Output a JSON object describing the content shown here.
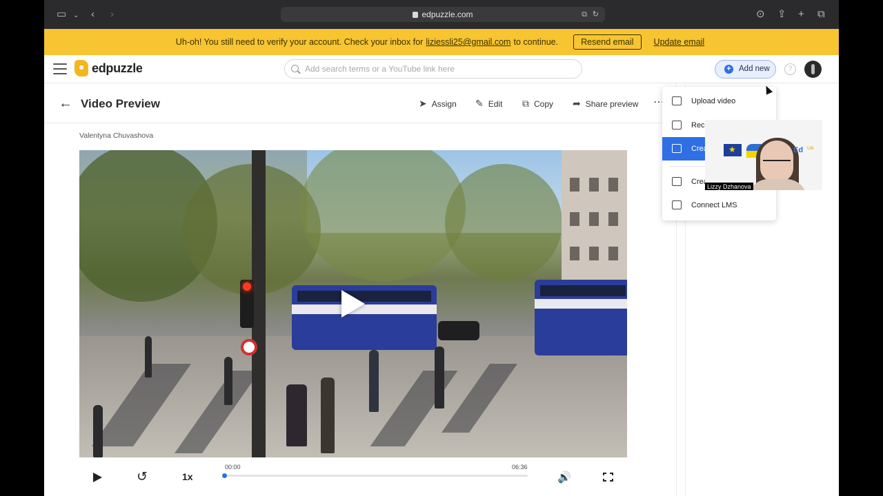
{
  "browser": {
    "url": "edpuzzle.com",
    "icons": [
      "sidebar-icon",
      "chevron-down-icon",
      "back-icon",
      "forward-icon",
      "translate-icon",
      "reload-icon",
      "download-icon",
      "share-icon",
      "plus-icon",
      "tabs-icon"
    ]
  },
  "banner": {
    "message_prefix": "Uh-oh! You still need to verify your account. Check your inbox for",
    "email": "liziessli25@gmail.com",
    "message_suffix": "to continue.",
    "resend_label": "Resend email",
    "update_label": "Update email",
    "color": "#f6c531"
  },
  "header": {
    "brand": "edpuzzle",
    "search_placeholder": "Add search terms or a YouTube link here",
    "add_new_label": "Add new",
    "help_glyph": "?",
    "accent": "#2f6fe5"
  },
  "toolbar": {
    "back_glyph": "←",
    "title": "Video Preview",
    "actions": [
      {
        "label": "Assign",
        "icon": "send-icon",
        "glyph": "➤"
      },
      {
        "label": "Edit",
        "icon": "pencil-icon",
        "glyph": "✎"
      },
      {
        "label": "Copy",
        "icon": "copy-icon",
        "glyph": "⧉"
      },
      {
        "label": "Share preview",
        "icon": "share-arrow-icon",
        "glyph": "➦"
      }
    ],
    "more_glyph": "⋯"
  },
  "video": {
    "author": "Valentyna Chuvashova",
    "speed": "1x",
    "current_time": "00:00",
    "duration": "06:36",
    "progress": 0,
    "replay_glyph": "↺",
    "volume_glyph": "🔊"
  },
  "dropdown": {
    "items": [
      {
        "label": "Upload video",
        "icon": "upload-file-icon",
        "active": false
      },
      {
        "label": "Reco",
        "icon": "record-video-icon",
        "active": false
      },
      {
        "label": "Crea",
        "icon": "pencil-icon",
        "active": true
      },
      {
        "label": "Crea",
        "icon": "class-icon",
        "active": false
      },
      {
        "label": "Connect LMS",
        "icon": "network-icon",
        "active": false
      }
    ]
  },
  "webcam": {
    "name": "Lizzy Dzhanova",
    "logo_text_b": "Ed",
    "logo_text_y": "UA"
  }
}
